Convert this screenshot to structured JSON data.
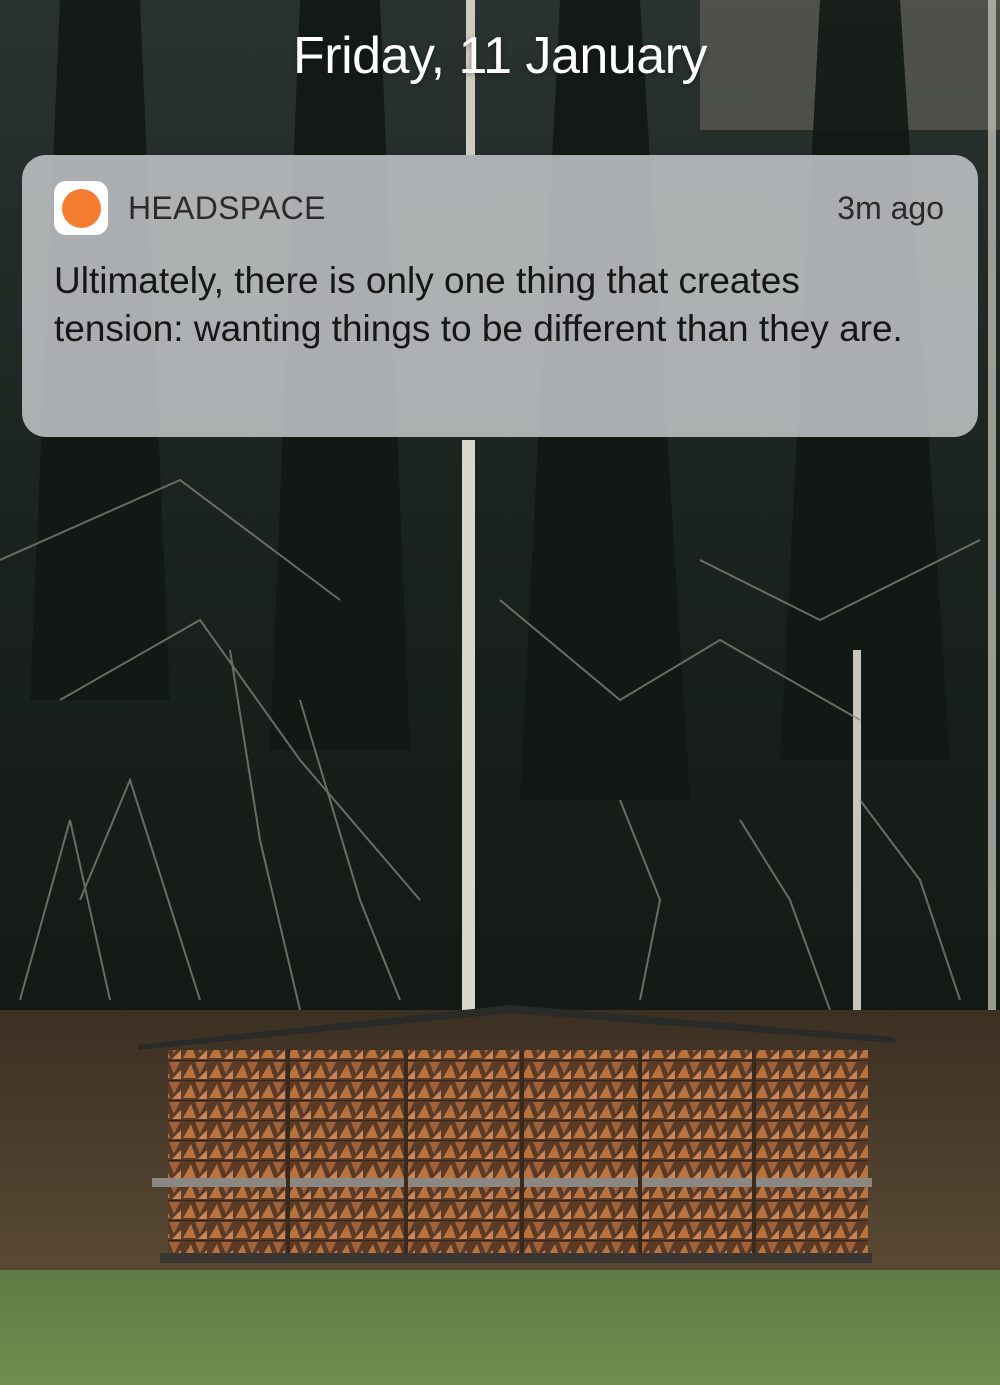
{
  "lockscreen": {
    "date": "Friday, 11 January"
  },
  "notification": {
    "app_name": "HEADSPACE",
    "app_icon": "headspace-orange-dot-icon",
    "time": "3m ago",
    "message": "Ultimately, there is only one thing that creates tension: wanting things to be different than they are."
  },
  "colors": {
    "brand_orange": "#f47d31",
    "notification_background": "#c4c7c9"
  }
}
